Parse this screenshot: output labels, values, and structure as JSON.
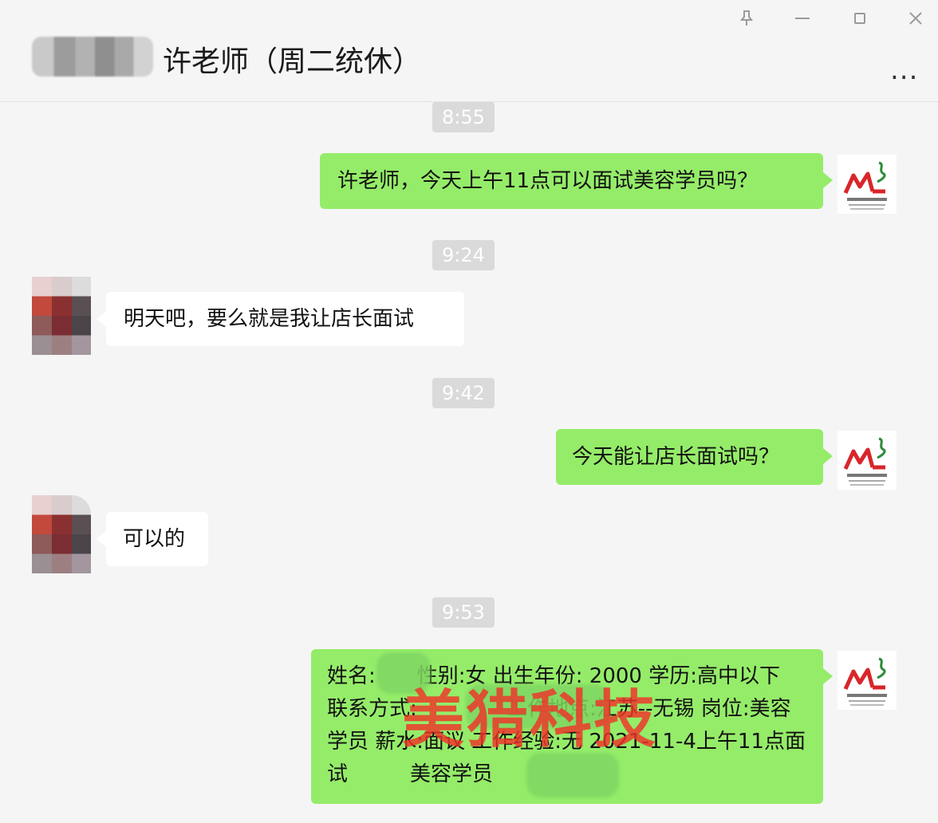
{
  "header": {
    "title": "许老师（周二统休）",
    "more_label": "..."
  },
  "window_controls": {
    "pin": "pin-icon",
    "minimize": "minimize-icon",
    "maximize": "maximize-icon",
    "close": "close-icon"
  },
  "messages": [
    {
      "time": "8:55"
    },
    {
      "sender": "self",
      "text": "许老师，今天上午11点可以面试美容学员吗？"
    },
    {
      "time": "9:24"
    },
    {
      "sender": "other",
      "text": "明天吧，要么就是我让店长面试"
    },
    {
      "time": "9:42"
    },
    {
      "sender": "self",
      "text": "今天能让店长面试吗？"
    },
    {
      "sender": "other",
      "text": "可以的"
    },
    {
      "time": "9:53"
    },
    {
      "sender": "self",
      "text": "姓名:　　性别:女 出生年份: 2000 学历:高中以下 联系方式:　　　　 工作地点:江苏--无锡 岗位:美容学员 薪水:面议 工作经验:无 2021-11-4上午11点面试　　　美容学员"
    }
  ],
  "watermark": "美猎科技",
  "colors": {
    "self_bubble": "#95ec69",
    "other_bubble": "#ffffff",
    "background": "#f5f5f5",
    "timestamp_bg": "#dadada",
    "watermark": "#f03228"
  }
}
